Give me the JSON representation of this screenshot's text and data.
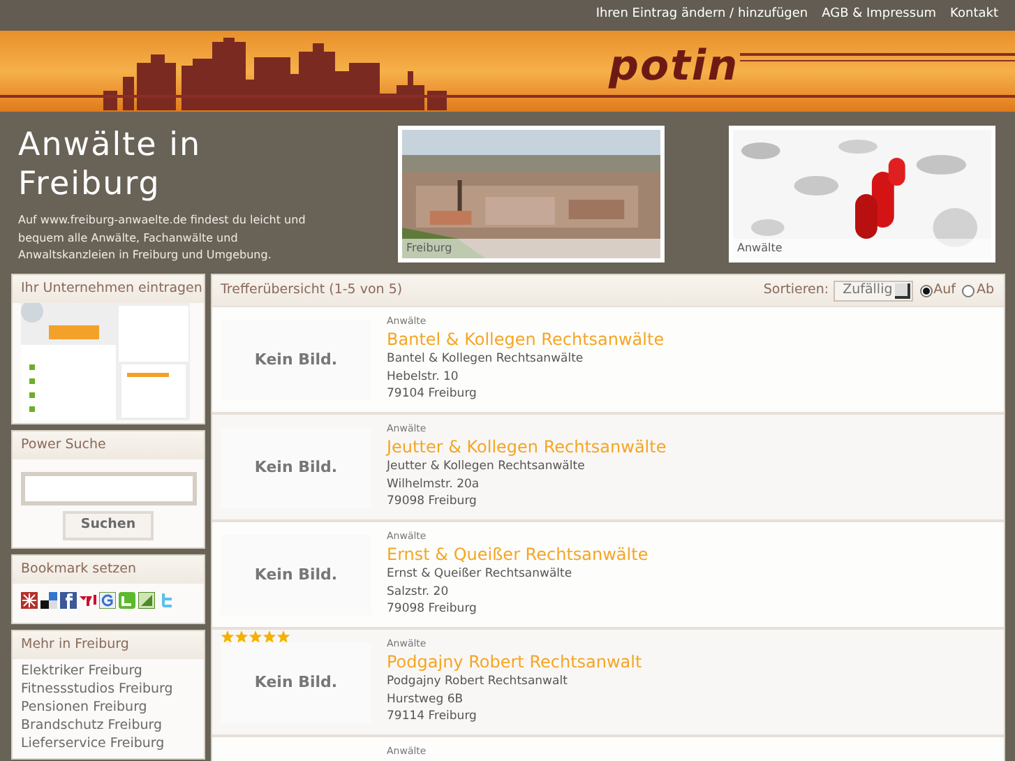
{
  "top_links": [
    "Ihren Eintrag ändern / hinzufügen",
    "AGB & Impressum",
    "Kontakt"
  ],
  "logo": "potin",
  "intro": {
    "title": "Anwälte in Freiburg",
    "text": "Auf www.freiburg-anwaelte.de findest du leicht und bequem alle Anwälte, Fachanwälte und Anwaltskanzleien in Freiburg und Umgebung."
  },
  "photos": [
    {
      "kind": "picture",
      "caption": "Freiburg"
    },
    {
      "kind": "picture",
      "caption": "Anwälte"
    }
  ],
  "sidebar": {
    "register": {
      "title": "Ihr Unternehmen eintragen",
      "kind": "picture"
    },
    "search": {
      "title": "Power Suche",
      "button": "Suchen"
    },
    "bookmarks": {
      "title": "Bookmark setzen"
    },
    "more": {
      "title": "Mehr in Freiburg",
      "links": [
        "Elektriker Freiburg",
        "Fitnessstudios Freiburg",
        "Pensionen Freiburg",
        "Brandschutz Freiburg",
        "Lieferservice Freiburg"
      ]
    }
  },
  "results": {
    "title": "Trefferübersicht (1-5 von 5)",
    "sort_label": "Sortieren:",
    "sort_value": "Zufällig",
    "order": [
      {
        "label": "Auf",
        "selected": true
      },
      {
        "label": "Ab",
        "selected": false
      }
    ],
    "entries": [
      {
        "no_image": "Kein Bild.",
        "category": "Anwälte",
        "name": "Bantel & Kollegen Rechtsanwälte",
        "lines": [
          "Bantel & Kollegen Rechtsanwälte",
          "Hebelstr. 10",
          "79104 Freiburg"
        ]
      },
      {
        "no_image": "Kein Bild.",
        "category": "Anwälte",
        "name": "Jeutter & Kollegen Rechtsanwälte",
        "lines": [
          "Jeutter & Kollegen Rechtsanwälte",
          "Wilhelmstr. 20a",
          "79098 Freiburg"
        ]
      },
      {
        "no_image": "Kein Bild.",
        "category": "Anwälte",
        "name": "Ernst & Queißer Rechtsanwälte",
        "lines": [
          "Ernst & Queißer Rechtsanwälte",
          "Salzstr. 20",
          "79098 Freiburg"
        ]
      },
      {
        "no_image": "Kein Bild.",
        "category": "Anwälte",
        "name": "Podgajny Robert Rechtsanwalt",
        "stars": 5,
        "lines": [
          "Podgajny Robert Rechtsanwalt",
          "Hurstweg 6B",
          "79114 Freiburg"
        ]
      },
      {
        "category": "Anwälte"
      }
    ]
  }
}
